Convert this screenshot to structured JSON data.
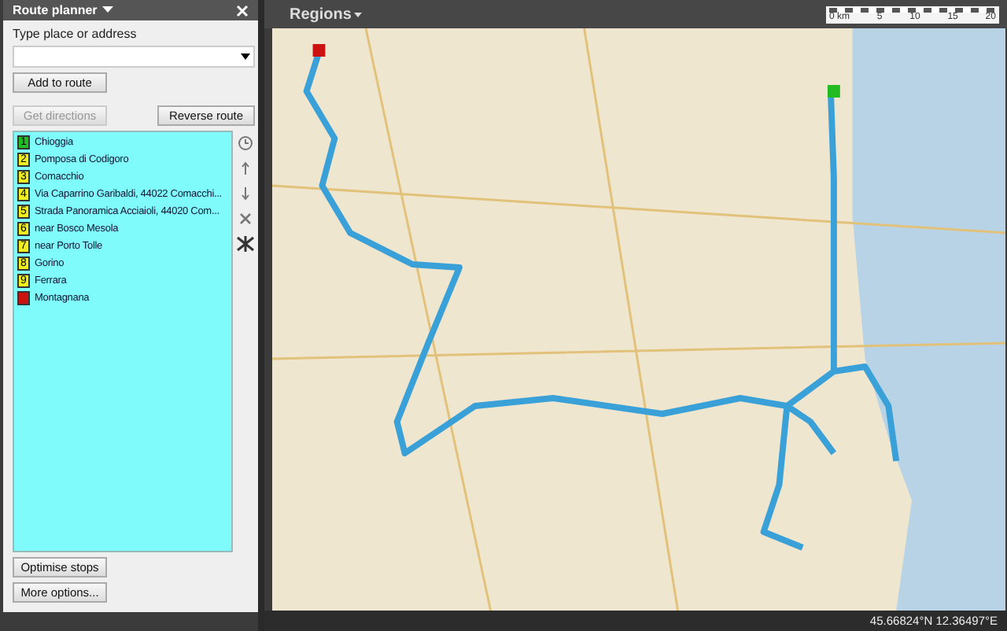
{
  "panel": {
    "title": "Route planner",
    "field_label": "Type place or address",
    "add_button": "Add to route",
    "get_directions": {
      "label": "Get directions",
      "disabled": true
    },
    "reverse_button": "Reverse route",
    "stops": [
      {
        "number": "1",
        "name": "Chioggia",
        "color": "#22bb22"
      },
      {
        "number": "2",
        "name": "Pomposa di Codigoro",
        "color": "#eeee22"
      },
      {
        "number": "3",
        "name": "Comacchio",
        "color": "#eeee22"
      },
      {
        "number": "4",
        "name": "Via Caparrino Garibaldi, 44022 Comacchi...",
        "color": "#eeee22"
      },
      {
        "number": "5",
        "name": "Strada Panoramica Acciaioli, 44020 Com...",
        "color": "#eeee22"
      },
      {
        "number": "6",
        "name": "near Bosco Mesola",
        "color": "#eeee22"
      },
      {
        "number": "7",
        "name": "near Porto Tolle",
        "color": "#eeee22"
      },
      {
        "number": "8",
        "name": "Gorino",
        "color": "#eeee22"
      },
      {
        "number": "9",
        "name": "Ferrara",
        "color": "#eeee22"
      },
      {
        "name": "Montagnana",
        "color": "#cc1111"
      }
    ],
    "optimise_button": "Optimise stops",
    "more_button": "More options..."
  },
  "map": {
    "title": "Regions",
    "scale_labels": [
      "0 km",
      "5",
      "10",
      "15",
      "20"
    ]
  },
  "status_bar": {
    "coordinates": "45.66824°N  12.36497°E"
  }
}
